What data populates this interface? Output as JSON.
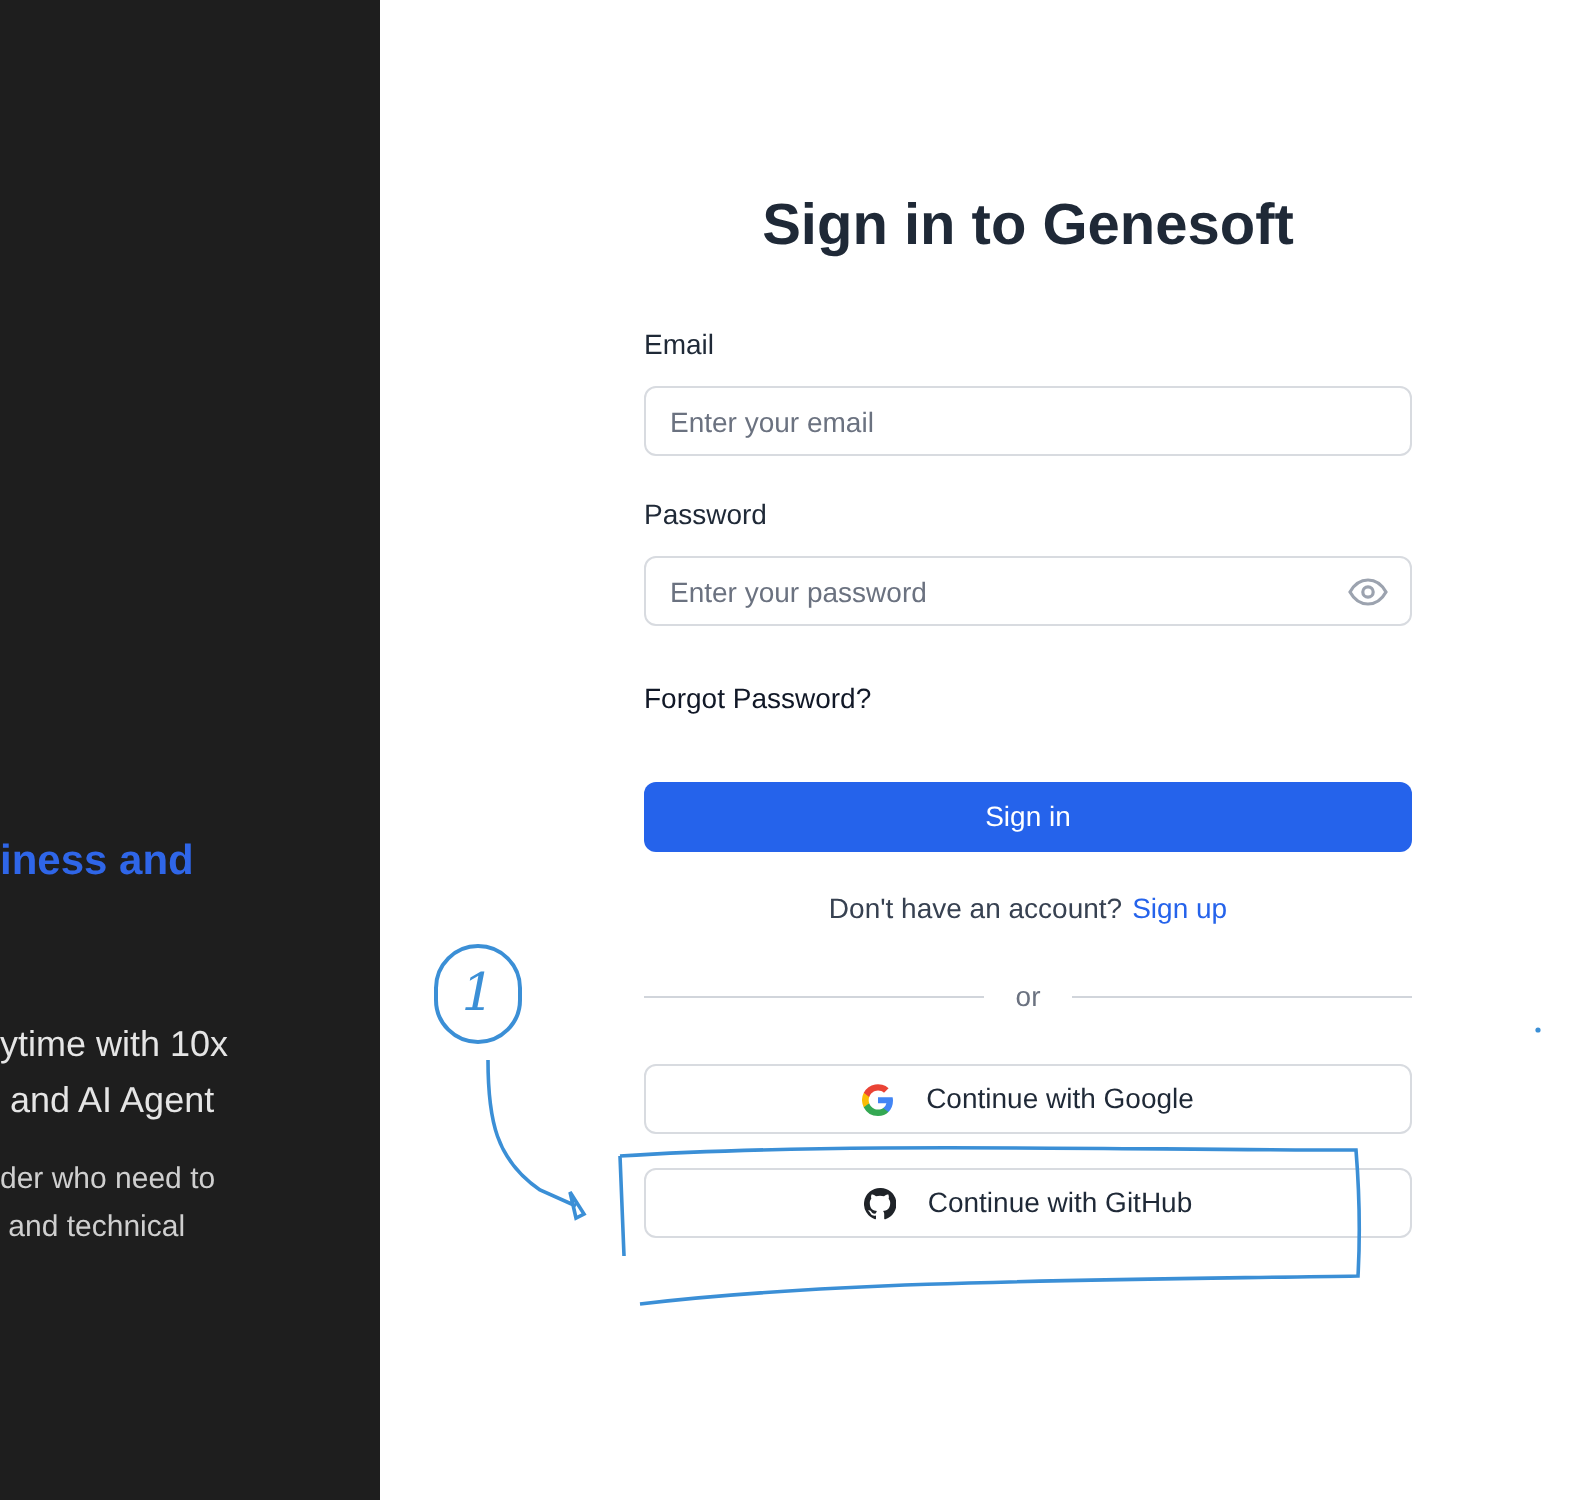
{
  "side_panel": {
    "headline": "iness and",
    "lead_lines": [
      "ytime with 10x",
      " and AI Agent"
    ],
    "body_lines": [
      "der who need to",
      " and technical"
    ]
  },
  "form": {
    "title": "Sign in to Genesoft",
    "fields": [
      {
        "label": "Email",
        "placeholder": "Enter your email",
        "kind": "text"
      },
      {
        "label": "Password",
        "placeholder": "Enter your password",
        "kind": "password"
      }
    ],
    "forgot_link": "Forgot Password?",
    "submit_button": "Sign in",
    "signup_prompt": "Don't have an account?",
    "signup_link": "Sign up",
    "divider": "or",
    "social_buttons": [
      {
        "label": "Continue with Google",
        "kind": "google"
      },
      {
        "label": "Continue with GitHub",
        "kind": "github"
      }
    ]
  },
  "annotation": {
    "marker": "1"
  }
}
